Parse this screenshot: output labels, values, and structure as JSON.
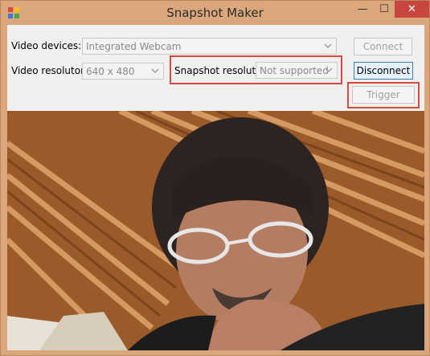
{
  "window": {
    "title": "Snapshot Maker",
    "buttons": {
      "minimize": "—",
      "maximize": "☐",
      "close": "✕"
    }
  },
  "form": {
    "video_devices_label": "Video devices:",
    "video_devices_value": "Integrated Webcam",
    "video_resolution_label": "Video resoluton:",
    "video_resolution_value": "640 x 480",
    "snapshot_resolution_label": "Snapshot resoluton:",
    "snapshot_resolution_value": "Not supported",
    "connect_label": "Connect",
    "disconnect_label": "Disconnect",
    "trigger_label": "Trigger"
  },
  "colors": {
    "frame": "#d9a77b",
    "close_button": "#c7463e",
    "highlight": "#d94a3d",
    "active_button_border": "#3c7fb1"
  },
  "icons": [
    "app-icon",
    "minimize-icon",
    "maximize-icon",
    "close-icon",
    "chevron-down-icon"
  ]
}
